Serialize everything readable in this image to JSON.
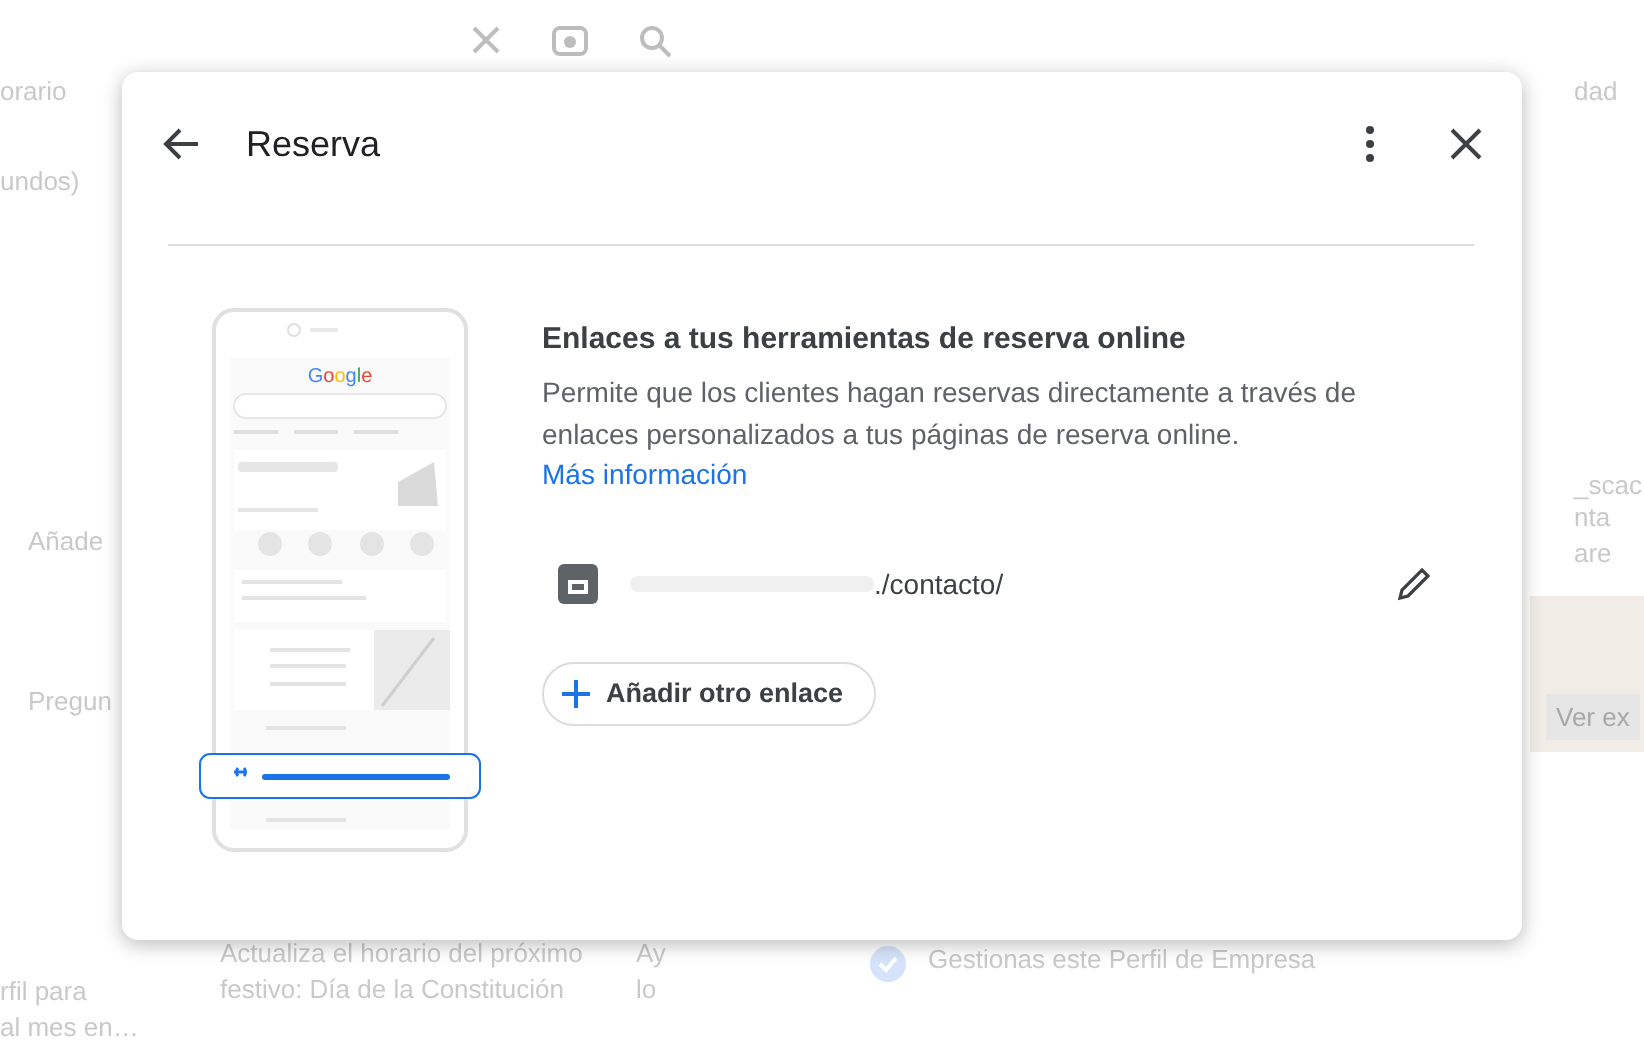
{
  "background": {
    "left_texts": [
      "orario",
      "undos)",
      "Añade",
      "Pregun",
      "rfil para",
      "al mes en…"
    ],
    "middle_text": "Actualiza el horario del próximo festivo: Día de la Constitución",
    "side_texts": [
      "Ay",
      "lo"
    ],
    "verified_text": "Gestionas este Perfil de Empresa",
    "right_texts": [
      "dad",
      "_scac",
      "nta",
      "are"
    ],
    "photo_button": "Ver ex"
  },
  "dialog": {
    "title": "Reserva",
    "illustration": {
      "logo": "Google"
    },
    "heading": "Enlaces a tus herramientas de reserva online",
    "description": "Permite que los clientes hagan reservas directamente a través de enlaces personalizados a tus páginas de reserva online.",
    "learn_more": "Más información",
    "links": [
      {
        "url": "./contacto/",
        "redacted": true
      }
    ],
    "add_button": "Añadir otro enlace"
  }
}
